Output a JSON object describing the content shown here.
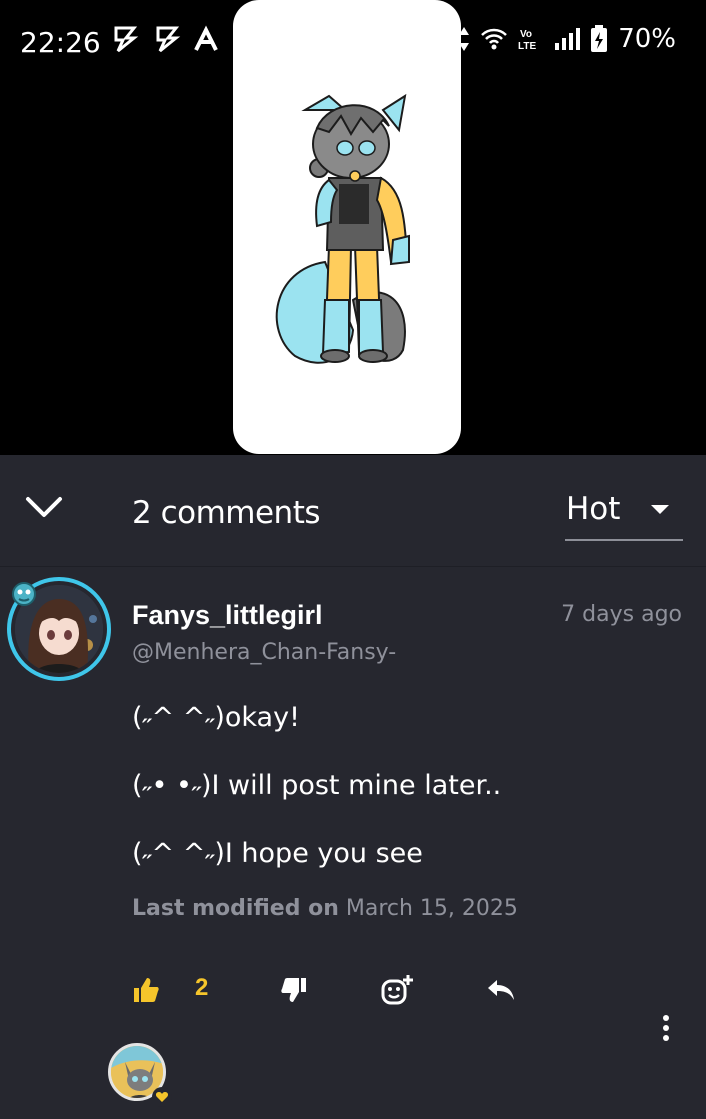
{
  "status_bar": {
    "time": "22:26",
    "battery": "70%",
    "network_label": "Vo LTE"
  },
  "comments_header": {
    "count_label": "2 comments",
    "sort_value": "Hot"
  },
  "comment": {
    "author_name": "Fanys_littlegirl",
    "author_handle": "@Menhera_Chan-Fansy-",
    "time": "7 days ago",
    "lines": [
      "(˶^ ^˶)okay!",
      "(˶• •˶)I will post mine later..",
      "(˶^ ^˶)I hope you see"
    ],
    "modified_label": "Last modified on",
    "modified_date": "March 15, 2025",
    "like_count": "2"
  },
  "colors": {
    "background": "#26272f",
    "accent_ring": "#3fc6ea",
    "like_yellow": "#f5c52b",
    "muted_text": "#8f919b"
  },
  "icons": {
    "collapse": "chevron-down-icon",
    "like": "thumbs-up-icon",
    "dislike": "thumbs-down-icon",
    "react": "add-reaction-icon",
    "reply": "reply-icon",
    "more": "more-vertical-icon"
  }
}
